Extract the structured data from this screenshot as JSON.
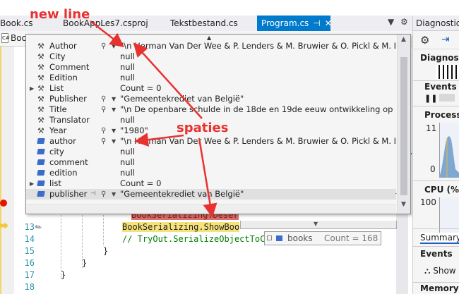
{
  "tabs": [
    {
      "label": "Book.cs",
      "active": false
    },
    {
      "label": "BookAppLes7.csproj",
      "active": false
    },
    {
      "label": "Tekstbestand.cs",
      "active": false
    },
    {
      "label": "Program.cs",
      "active": true
    }
  ],
  "tab_pin": "⊣",
  "tab_close": "✕",
  "strip_dropdown": "▼",
  "strip_settings": "⚙",
  "nav_bar": {
    "icon": "C#",
    "label": "Boo"
  },
  "line_numbers": [
    "13",
    "14",
    "15",
    "16",
    "17",
    "18"
  ],
  "code": {
    "error_line": "BookSerializing.Deser",
    "line13": "BookSerializing.ShowBoo",
    "line14": "// TryOut.SerializeObjectToC",
    "line15": "}",
    "line16": "}",
    "line17": "}"
  },
  "datatip": {
    "rows": [
      {
        "name": "Author",
        "kind": "property",
        "expand": false,
        "mag": true,
        "value": "\"\\n     Herman Van Der Wee & P. Lenders & M. Bruwier & O. Pickl & M. Lévy..."
      },
      {
        "name": "City",
        "kind": "property",
        "expand": false,
        "mag": false,
        "value": "null"
      },
      {
        "name": "Comment",
        "kind": "property",
        "expand": false,
        "mag": false,
        "value": "null"
      },
      {
        "name": "Edition",
        "kind": "property",
        "expand": false,
        "mag": false,
        "value": "null"
      },
      {
        "name": "List",
        "kind": "property",
        "expand": true,
        "mag": false,
        "value": "Count = 0"
      },
      {
        "name": "Publisher",
        "kind": "property",
        "expand": false,
        "mag": true,
        "value": "\"Gemeentekrediet van België\""
      },
      {
        "name": "Title",
        "kind": "property",
        "expand": false,
        "mag": true,
        "value": "\"\\n     De openbare schulde in de 18de en 19de eeuw ontwikkeling op het pla..."
      },
      {
        "name": "Translator",
        "kind": "property",
        "expand": false,
        "mag": false,
        "value": "null"
      },
      {
        "name": "Year",
        "kind": "property",
        "expand": false,
        "mag": true,
        "value": "\"1980\""
      },
      {
        "name": "author",
        "kind": "field",
        "expand": false,
        "mag": true,
        "value": "\"\\n     Herman Van Der Wee & P. Lenders & M. Bruwier & O. Pickl & M. Lévy..."
      },
      {
        "name": "city",
        "kind": "field",
        "expand": false,
        "mag": false,
        "value": "null"
      },
      {
        "name": "comment",
        "kind": "field",
        "expand": false,
        "mag": false,
        "value": "null"
      },
      {
        "name": "edition",
        "kind": "field",
        "expand": false,
        "mag": false,
        "value": "null"
      },
      {
        "name": "list",
        "kind": "field",
        "expand": true,
        "mag": false,
        "value": "Count = 0"
      },
      {
        "name": "publisher",
        "kind": "field",
        "expand": false,
        "mag": true,
        "pinned": true,
        "value": "\"Gemeentekrediet van België\""
      }
    ]
  },
  "minitip": {
    "name": "books",
    "value": "Count = 168"
  },
  "annotations": {
    "new_line": "new line",
    "spaties": "spaties",
    "color": "#e8322f"
  },
  "diagnostics": {
    "title": "Diagnostic T",
    "heading": "Diagnostic",
    "events_header": "Events",
    "process_memory": "Process M",
    "mem_value": "11",
    "mem_zero": "0",
    "cpu_label": "CPU (% o",
    "cpu_100": "100",
    "cpu_0": "0",
    "summary_tab": "Summary",
    "events_section": "Events",
    "show_label": "Show",
    "memory_usage": "Memory Us"
  }
}
